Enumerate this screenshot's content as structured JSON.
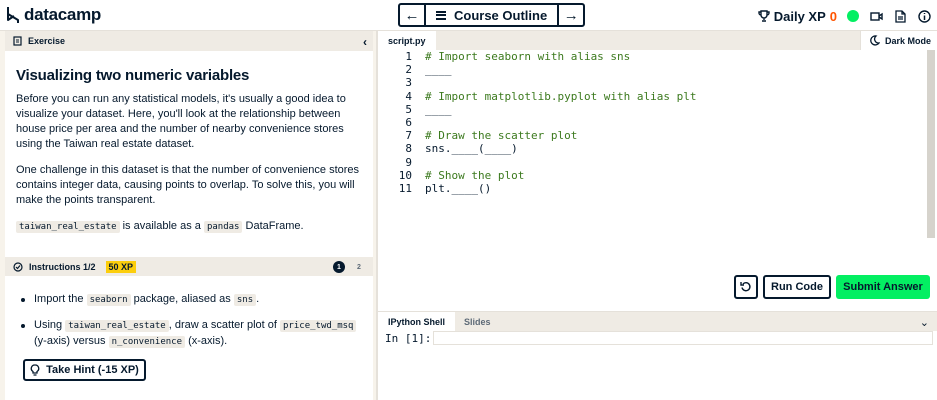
{
  "header": {
    "logo_text": "datacamp",
    "nav_prev": "←",
    "course_outline": "Course Outline",
    "nav_next": "→",
    "daily_xp_label": "Daily XP",
    "daily_xp_value": "0"
  },
  "exercise": {
    "section_label": "Exercise",
    "title": "Visualizing two numeric variables",
    "paragraph1": "Before you can run any statistical models, it's usually a good idea to visualize your dataset. Here, you'll look at the relationship between house price per area and the number of nearby convenience stores using the Taiwan real estate dataset.",
    "paragraph2": "One challenge in this dataset is that the number of convenience stores contains integer data, causing points to overlap. To solve this, you will make the points transparent.",
    "p3_code1": "taiwan_real_estate",
    "p3_text1": " is available as a ",
    "p3_code2": "pandas",
    "p3_text2": " DataFrame."
  },
  "instructions": {
    "label": "Instructions 1/2",
    "xp": "50 XP",
    "step1": "1",
    "step2": "2",
    "item1": {
      "t1": "Import the ",
      "c1": "seaborn",
      "t2": " package, aliased as ",
      "c2": "sns",
      "t3": "."
    },
    "item2": {
      "t1": "Using ",
      "c1": "taiwan_real_estate",
      "t2": ", draw a scatter plot of ",
      "c2": "price_twd_msq",
      "t3": " (y-axis) versus ",
      "c3": "n_convenience",
      "t4": " (x-axis)."
    },
    "hint_label": "Take Hint (-15 XP)"
  },
  "editor": {
    "file_tab": "script.py",
    "dark_mode_label": "Dark Mode",
    "line_numbers": [
      "1",
      "2",
      "3",
      "4",
      "5",
      "6",
      "7",
      "8",
      "9",
      "10",
      "11"
    ],
    "lines": [
      "# Import seaborn with alias sns",
      "____",
      "",
      "# Import matplotlib.pyplot with alias plt",
      "____",
      "",
      "# Draw the scatter plot",
      "sns.____(____)",
      "",
      "# Show the plot",
      "plt.____()"
    ],
    "run_label": "Run Code",
    "submit_label": "Submit Answer"
  },
  "console": {
    "tab_shell": "IPython Shell",
    "tab_slides": "Slides",
    "prompt": "In [1]:"
  },
  "colors": {
    "brand_navy": "#05192d",
    "submit_green": "#03ef62",
    "xp_orange": "#ff5400",
    "xp_badge_yellow": "#fcce0d"
  }
}
